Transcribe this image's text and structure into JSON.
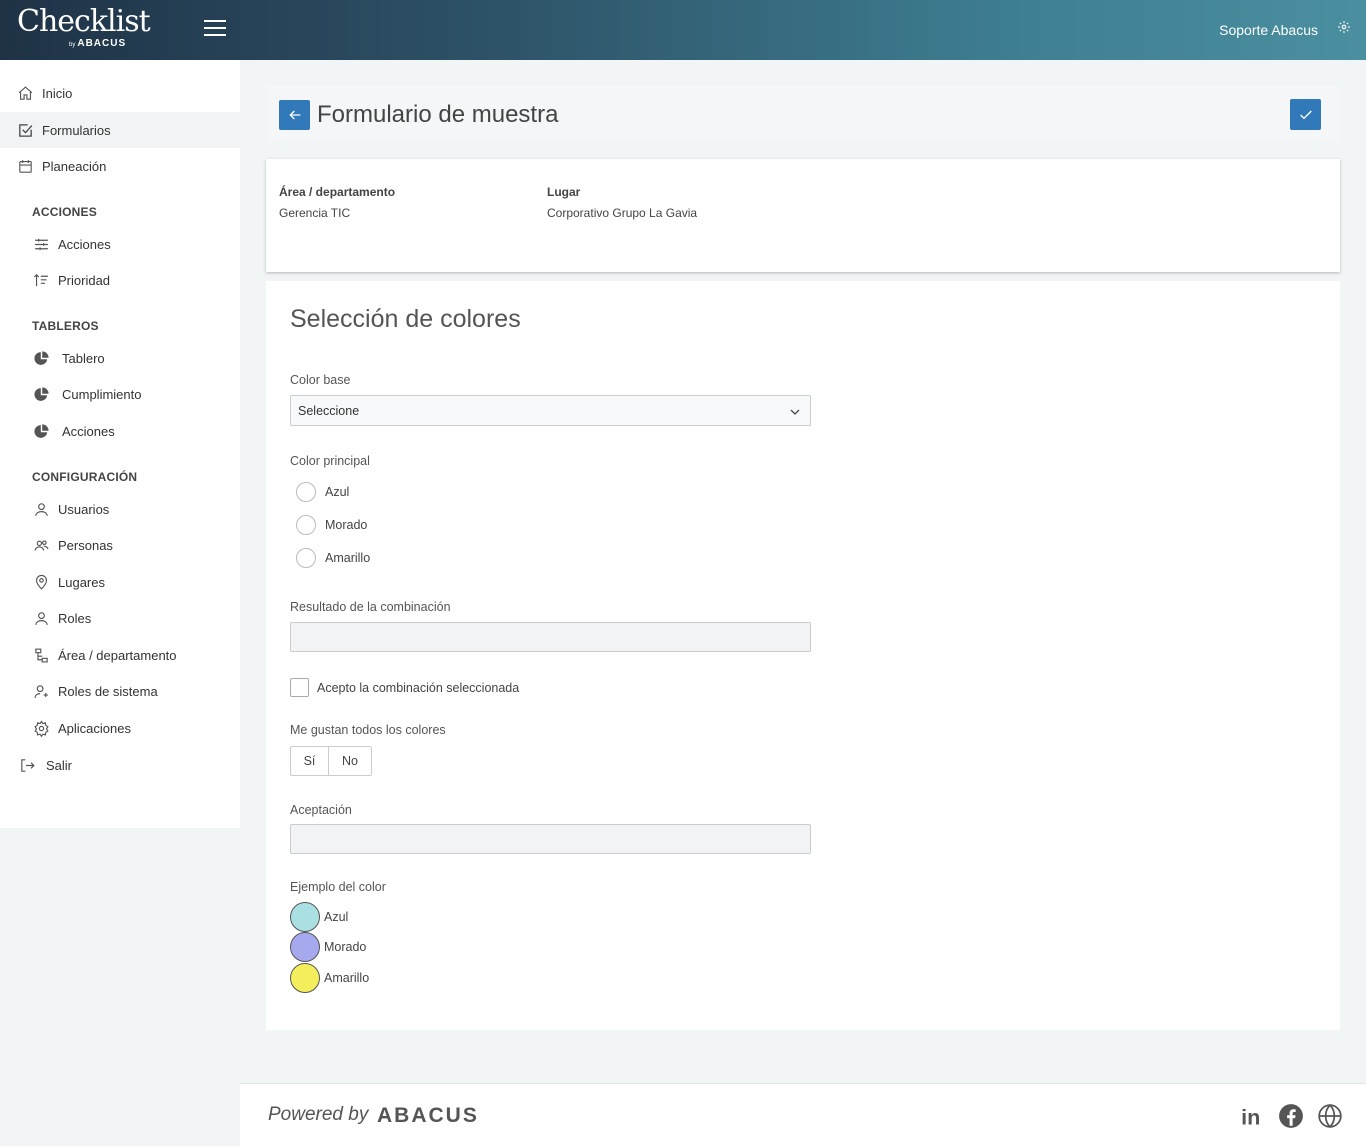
{
  "app": {
    "logo_text": "Checklist",
    "logo_by": "by",
    "logo_brand": "ABACUS",
    "user_name": "Soporte Abacus"
  },
  "sidebar": {
    "top_items": [
      {
        "label": "Inicio",
        "icon": "home-icon"
      },
      {
        "label": "Formularios",
        "icon": "checkbox-icon",
        "active": true
      },
      {
        "label": "Planeación",
        "icon": "calendar-icon"
      }
    ],
    "sections": [
      {
        "header": "ACCIONES",
        "items": [
          {
            "label": "Acciones",
            "icon": "sliders-icon"
          },
          {
            "label": "Prioridad",
            "icon": "sort-icon"
          }
        ]
      },
      {
        "header": "TABLEROS",
        "items": [
          {
            "label": "Tablero",
            "icon": "pie-chart-icon"
          },
          {
            "label": "Cumplimiento",
            "icon": "pie-chart-icon"
          },
          {
            "label": "Acciones",
            "icon": "pie-chart-icon"
          }
        ]
      },
      {
        "header": "CONFIGURACIÓN",
        "items": [
          {
            "label": "Usuarios",
            "icon": "user-icon"
          },
          {
            "label": "Personas",
            "icon": "users-icon"
          },
          {
            "label": "Lugares",
            "icon": "map-pin-icon"
          },
          {
            "label": "Roles",
            "icon": "user-icon"
          },
          {
            "label": "Área / departamento",
            "icon": "org-chart-icon"
          },
          {
            "label": "Roles de sistema",
            "icon": "user-plus-icon"
          },
          {
            "label": "Aplicaciones",
            "icon": "gear-icon"
          }
        ]
      }
    ],
    "logout": {
      "label": "Salir",
      "icon": "logout-icon"
    }
  },
  "page": {
    "title": "Formulario de muestra"
  },
  "info": {
    "area_label": "Área / departamento",
    "area_value": "Gerencia TIC",
    "place_label": "Lugar",
    "place_value": "Corporativo Grupo La Gavia"
  },
  "form": {
    "section_title": "Selección de colores",
    "color_base": {
      "label": "Color base",
      "selected": "Seleccione"
    },
    "color_principal": {
      "label": "Color principal",
      "options": [
        "Azul",
        "Morado",
        "Amarillo"
      ]
    },
    "resultado": {
      "label": "Resultado de la combinación",
      "value": ""
    },
    "acepto": {
      "label": "Acepto la combinación seleccionada",
      "checked": false
    },
    "me_gustan": {
      "label": "Me gustan todos los colores",
      "yes": "Sí",
      "no": "No"
    },
    "aceptacion": {
      "label": "Aceptación",
      "value": ""
    },
    "ejemplo": {
      "label": "Ejemplo del color",
      "swatches": [
        {
          "label": "Azul",
          "color": "#abe0e3"
        },
        {
          "label": "Morado",
          "color": "#a6a9ee"
        },
        {
          "label": "Amarillo",
          "color": "#f5ee5c"
        }
      ]
    }
  },
  "footer": {
    "powered_by": "Powered by",
    "brand": "ABACUS"
  },
  "colors": {
    "primary": "#3179b8"
  }
}
